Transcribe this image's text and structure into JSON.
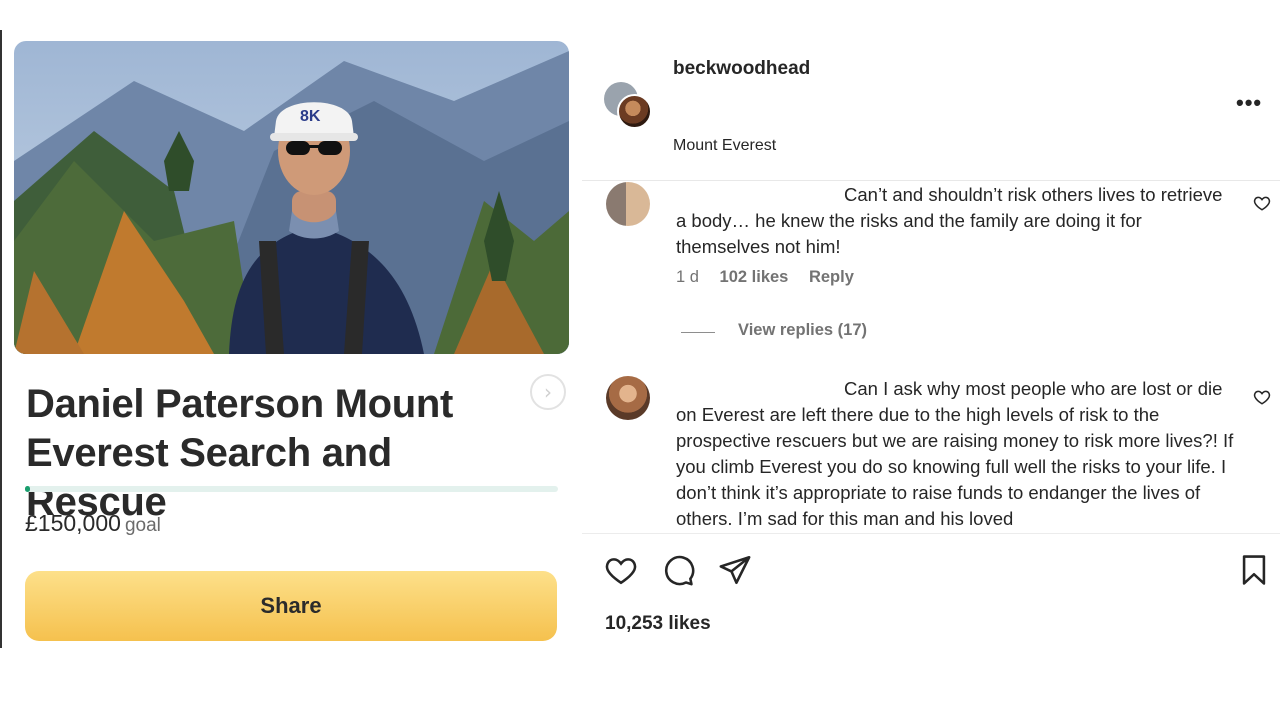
{
  "fundraiser": {
    "title": "Daniel Paterson Mount Everest Search and Rescue",
    "goal_amount": "£150,000",
    "goal_label": "goal",
    "progress_fraction": 0.01,
    "share_label": "Share",
    "hero_cap_text": "8K",
    "next_icon": "chevron-right-icon"
  },
  "post": {
    "author": "beckwoodhead",
    "location": "Mount Everest",
    "more_icon": "•••",
    "likes": "10,253 likes",
    "comments": [
      {
        "text": "Can’t and shouldn’t risk others lives to retrieve a body… he knew the risks and the family are doing it for themselves not him!",
        "age": "1 d",
        "likes": "102 likes",
        "reply_label": "Reply",
        "view_replies": "View replies (17)"
      },
      {
        "text": "Can I ask why most people who are lost or die on Everest are left there due to the high levels of risk to the prospective rescuers but we are raising money to risk more lives?! If you climb Everest you do so knowing full well the risks to your life. I don’t think it’s appropriate to raise funds to endanger the lives of others. I’m sad for this man and his loved"
      }
    ]
  },
  "colors": {
    "progress_fill": "#1a9e6e",
    "share_button": "#f7c955",
    "text": "#262626"
  }
}
